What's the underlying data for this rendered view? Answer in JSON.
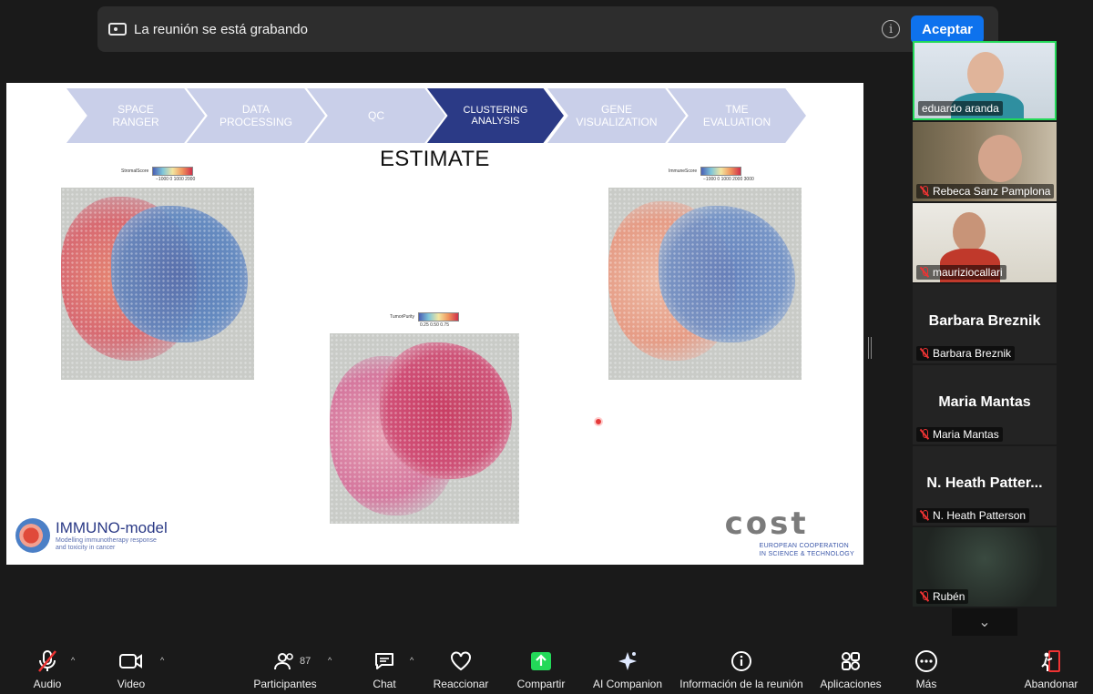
{
  "banner": {
    "text": "La reunión se está grabando",
    "accept_label": "Aceptar",
    "info_glyph": "i"
  },
  "slide": {
    "steps": [
      {
        "label": "SPACE\nRANGER",
        "active": false
      },
      {
        "label": "DATA\nPROCESSING",
        "active": false
      },
      {
        "label": "QC",
        "active": false
      },
      {
        "label": "CLUSTERING\nANALYSIS",
        "active": true
      },
      {
        "label": "GENE\nVISUALIZATION",
        "active": false
      },
      {
        "label": "TME\nEVALUATION",
        "active": false
      }
    ],
    "title": "ESTIMATE",
    "panels": [
      {
        "legend": "StromalScore",
        "ticks": "−1000  0  1000 2000"
      },
      {
        "legend": "TumorPurity",
        "ticks": "0.25  0.50  0.75"
      },
      {
        "legend": "ImmuneScore",
        "ticks": "−1000 0  1000 2000 3000"
      }
    ],
    "immuno_logo": {
      "name": "IMMUNO-model",
      "tagline": "Modelling immunotherapy response\nand toxicity in cancer"
    },
    "cost_logo": {
      "name": "cost",
      "tagline": "EUROPEAN COOPERATION\nIN SCIENCE & TECHNOLOGY"
    }
  },
  "participants_panel": {
    "tiles": [
      {
        "name": "eduardo aranda",
        "type": "video",
        "muted": false,
        "active": true
      },
      {
        "name": "Rebeca Sanz Pamplona",
        "type": "video",
        "muted": true,
        "active": false
      },
      {
        "name": "mauriziocallari",
        "type": "video",
        "muted": true,
        "active": false
      },
      {
        "name": "Barbara Breznik",
        "display": "Barbara Breznik",
        "type": "name",
        "muted": true
      },
      {
        "name": "Maria Mantas",
        "display": "Maria Mantas",
        "type": "name",
        "muted": true
      },
      {
        "name": "N. Heath Patterson",
        "display": "N. Heath Patter...",
        "type": "name",
        "muted": true
      },
      {
        "name": "Rubén",
        "type": "blank",
        "muted": true
      }
    ],
    "scroll_glyph": "⌄"
  },
  "toolbar": {
    "audio": "Audio",
    "video": "Video",
    "participants": "Participantes",
    "participants_count": "87",
    "chat": "Chat",
    "react": "Reaccionar",
    "share": "Compartir",
    "ai": "AI Companion",
    "info": "Información de la reunión",
    "apps": "Aplicaciones",
    "more": "Más",
    "leave": "Abandonar",
    "caret": "^"
  },
  "colors": {
    "accent": "#0e72ed",
    "active_border": "#23d959",
    "share_green": "#23d959",
    "muted_red": "#e33333",
    "chevron_dark": "#2b3a86",
    "chevron_light": "#c9cfe9"
  }
}
